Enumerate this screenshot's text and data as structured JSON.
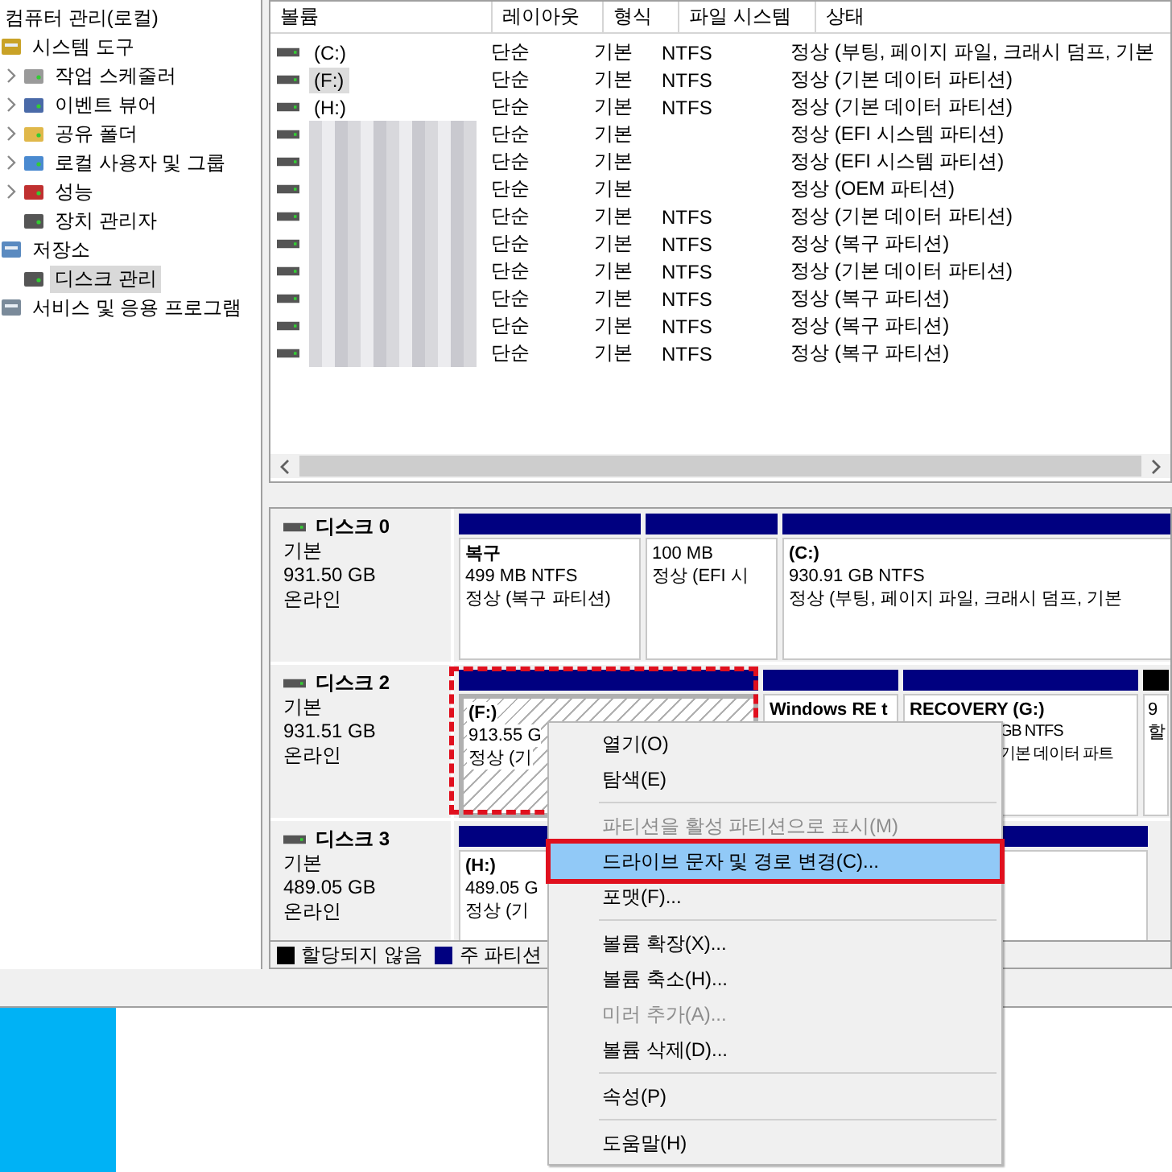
{
  "tree": {
    "label": "컴퓨터 관리(로컬)",
    "children": [
      {
        "label": "시스템 도구",
        "selected": false,
        "children": [
          {
            "label": "작업 스케줄러",
            "expandable": true,
            "selected": false
          },
          {
            "label": "이벤트 뷰어",
            "expandable": true,
            "selected": false
          },
          {
            "label": "공유 폴더",
            "expandable": true,
            "selected": false
          },
          {
            "label": "로컬 사용자 및 그룹",
            "expandable": true,
            "selected": false
          },
          {
            "label": "성능",
            "expandable": true,
            "selected": false
          },
          {
            "label": "장치 관리자",
            "expandable": false,
            "selected": false
          }
        ]
      },
      {
        "label": "저장소",
        "selected": false,
        "children": [
          {
            "label": "디스크 관리",
            "expandable": false,
            "selected": true
          }
        ]
      },
      {
        "label": "서비스 및 응용 프로그램",
        "selected": false
      }
    ]
  },
  "volume_table": {
    "columns": [
      "볼륨",
      "레이아웃",
      "형식",
      "파일 시스템",
      "상태"
    ],
    "rows": [
      {
        "volume": "(C:)",
        "redacted": false,
        "selected": false,
        "layout": "단순",
        "type": "기본",
        "file_system": "NTFS",
        "status": "정상 (부팅, 페이지 파일, 크래시 덤프, 기본"
      },
      {
        "volume": "(F:)",
        "redacted": false,
        "selected": true,
        "layout": "단순",
        "type": "기본",
        "file_system": "NTFS",
        "status": "정상 (기본 데이터 파티션)"
      },
      {
        "volume": "(H:)",
        "redacted": false,
        "selected": false,
        "layout": "단순",
        "type": "기본",
        "file_system": "NTFS",
        "status": "정상 (기본 데이터 파티션)"
      },
      {
        "redacted": true,
        "selected": false,
        "layout": "단순",
        "type": "기본",
        "status": "정상 (EFI 시스템 파티션)"
      },
      {
        "redacted": true,
        "selected": false,
        "layout": "단순",
        "type": "기본",
        "status": "정상 (EFI 시스템 파티션)"
      },
      {
        "redacted": true,
        "selected": false,
        "layout": "단순",
        "type": "기본",
        "status": "정상 (OEM 파티션)"
      },
      {
        "redacted": true,
        "selected": false,
        "layout": "단순",
        "type": "기본",
        "file_system": "NTFS",
        "status": "정상 (기본 데이터 파티션)"
      },
      {
        "redacted": true,
        "selected": false,
        "layout": "단순",
        "type": "기본",
        "file_system": "NTFS",
        "status": "정상 (복구 파티션)"
      },
      {
        "redacted": true,
        "selected": false,
        "layout": "단순",
        "type": "기본",
        "file_system": "NTFS",
        "status": "정상 (기본 데이터 파티션)"
      },
      {
        "redacted": true,
        "selected": false,
        "layout": "단순",
        "type": "기본",
        "file_system": "NTFS",
        "status": "정상 (복구 파티션)"
      },
      {
        "redacted": true,
        "selected": false,
        "layout": "단순",
        "type": "기본",
        "file_system": "NTFS",
        "status": "정상 (복구 파티션)"
      },
      {
        "redacted": true,
        "selected": false,
        "layout": "단순",
        "type": "기본",
        "file_system": "NTFS",
        "status": "정상 (복구 파티션)"
      }
    ]
  },
  "disks": [
    {
      "name": "디스크 0",
      "type": "기본",
      "size": "931.50 GB",
      "state": "온라인",
      "partitions": [
        {
          "kind": "primary",
          "selected": false,
          "annotated": false,
          "lines": [
            "복구",
            "499 MB NTFS",
            "정상 (복구 파티션)"
          ]
        },
        {
          "kind": "primary",
          "selected": false,
          "annotated": false,
          "lines": [
            "100 MB",
            "정상 (EFI 시"
          ]
        },
        {
          "kind": "primary",
          "selected": false,
          "annotated": false,
          "lines": [
            "(C:)",
            "930.91 GB NTFS",
            "정상 (부팅, 페이지 파일, 크래시 덤프, 기본"
          ]
        }
      ]
    },
    {
      "name": "디스크 2",
      "type": "기본",
      "size": "931.51 GB",
      "state": "온라인",
      "partitions": [
        {
          "kind": "primary",
          "selected": true,
          "annotated": true,
          "lines": [
            "(F:)",
            "913.55 G",
            "정상 (기"
          ]
        },
        {
          "kind": "primary",
          "selected": false,
          "annotated": false,
          "lines": [
            "Windows RE t"
          ]
        },
        {
          "kind": "primary",
          "selected": false,
          "annotated": false,
          "lines": [
            "RECOVERY  (G:)",
            "GB NTFS",
            "기본 데이터 파트"
          ]
        },
        {
          "kind": "unallocated",
          "selected": false,
          "annotated": false,
          "lines": [
            "9",
            "할"
          ]
        }
      ]
    },
    {
      "name": "디스크 3",
      "type": "기본",
      "size": "489.05 GB",
      "state": "온라인",
      "partitions": [
        {
          "kind": "primary",
          "selected": false,
          "annotated": false,
          "lines": [
            "(H:)",
            "489.05 G",
            "정상 (기"
          ]
        }
      ]
    }
  ],
  "legend": [
    {
      "label": "할당되지 않음",
      "kind": "unallocated"
    },
    {
      "label": "주 파티션",
      "kind": "primary"
    }
  ],
  "context_menu": [
    {
      "kind": "item",
      "label": "열기(O)",
      "disabled": false,
      "selected": false,
      "annotated": false
    },
    {
      "kind": "item",
      "label": "탐색(E)",
      "disabled": false,
      "selected": false,
      "annotated": false
    },
    {
      "kind": "separator"
    },
    {
      "kind": "item",
      "label": "파티션을 활성 파티션으로 표시(M)",
      "disabled": true,
      "selected": false,
      "annotated": false
    },
    {
      "kind": "item",
      "label": "드라이브 문자 및 경로 변경(C)...",
      "disabled": false,
      "selected": true,
      "annotated": true
    },
    {
      "kind": "item",
      "label": "포맷(F)...",
      "disabled": false,
      "selected": false,
      "annotated": false
    },
    {
      "kind": "separator"
    },
    {
      "kind": "item",
      "label": "볼륨 확장(X)...",
      "disabled": false,
      "selected": false,
      "annotated": false
    },
    {
      "kind": "item",
      "label": "볼륨 축소(H)...",
      "disabled": false,
      "selected": false,
      "annotated": false
    },
    {
      "kind": "item",
      "label": "미러 추가(A)...",
      "disabled": true,
      "selected": false,
      "annotated": false
    },
    {
      "kind": "item",
      "label": "볼륨 삭제(D)...",
      "disabled": false,
      "selected": false,
      "annotated": false
    },
    {
      "kind": "separator"
    },
    {
      "kind": "item",
      "label": "속성(P)",
      "disabled": false,
      "selected": false,
      "annotated": false
    },
    {
      "kind": "separator"
    },
    {
      "kind": "item",
      "label": "도움말(H)",
      "disabled": false,
      "selected": false,
      "annotated": false
    }
  ]
}
